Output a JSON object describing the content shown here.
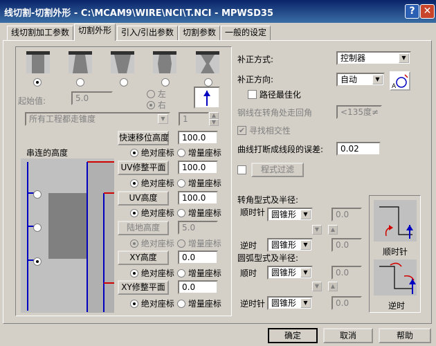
{
  "window": {
    "title": "线切割-切割外形 - C:\\MCAM9\\WIRE\\NCI\\T.NCI - MPWSD35",
    "help": "?",
    "close": "✕"
  },
  "tabs": [
    "线切割加工参数",
    "切割外形",
    "引入/引出参数",
    "切割参数",
    "一般的设定"
  ],
  "left": {
    "start_value_label": "起始值:",
    "start_value": "5.0",
    "direction_left": "左",
    "direction_right": "右",
    "taper_select": "所有工程都走锥度",
    "taper_count": "1",
    "height_title": "串连的高度",
    "abs": "绝对座标",
    "inc": "增量座标",
    "rows": [
      {
        "label": "快速移位高度",
        "value": "100.0",
        "enabled": true
      },
      {
        "label": "UV修整平面",
        "value": "100.0",
        "enabled": true
      },
      {
        "label": "UV高度",
        "value": "100.0",
        "enabled": true
      },
      {
        "label": "陆地高度",
        "value": "5.0",
        "enabled": false
      },
      {
        "label": "XY高度",
        "value": "0.0",
        "enabled": true
      },
      {
        "label": "XY修整平面",
        "value": "0.0",
        "enabled": true
      }
    ]
  },
  "right": {
    "comp_type_label": "补正方式:",
    "comp_type": "控制器",
    "comp_dir_label": "补正方向:",
    "comp_dir": "自动",
    "path_opt": "路径最佳化",
    "wire_corner_label": "钢线在转角处走回角",
    "wire_corner": "<135度≠",
    "find_intersect": "寻找相交性",
    "tolerance_label": "曲线打断成线段的误差:",
    "tolerance": "0.02",
    "filter": "程式过滤",
    "corner_title": "转角型式及半径:",
    "cw": "顺时针",
    "ccw": "逆时",
    "cone": "圆锥形",
    "radius_cw": "0.0",
    "radius_ccw": "0.0",
    "arc_title": "圆弧型式及半径:",
    "arc_cw": "顺时",
    "arc_ccw": "逆时针",
    "arc_radius_cw": "0.0",
    "arc_radius_ccw": "0.0",
    "preview_cw": "顺时针",
    "preview_ccw": "逆时"
  },
  "footer": {
    "ok": "确定",
    "cancel": "取消",
    "help": "帮助"
  }
}
